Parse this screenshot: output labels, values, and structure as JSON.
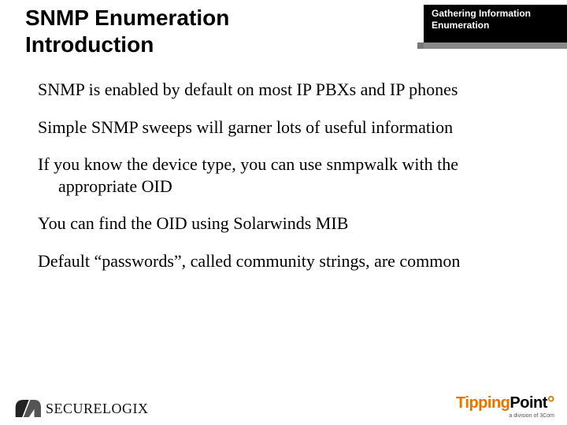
{
  "header": {
    "title_line1": "SNMP Enumeration",
    "title_line2": "Introduction",
    "chapter_line1": "Gathering Information",
    "chapter_line2": "Enumeration"
  },
  "bullets": {
    "b1": "SNMP is enabled by default on most IP PBXs and IP phones",
    "b2": "Simple SNMP sweeps will garner lots of useful information",
    "b3": "If you know the device type, you can use snmpwalk with the appropriate OID",
    "b4": "You can find the OID using Solarwinds MIB",
    "b5": "Default “passwords”, called community strings, are common"
  },
  "footer": {
    "left_logo_text_a": "S",
    "left_logo_text_b": "ECURE",
    "left_logo_text_c": "L",
    "left_logo_text_d": "OGIX",
    "right_logo_a": "Tipping",
    "right_logo_b": "Point",
    "right_sub": "a division of 3Com"
  }
}
